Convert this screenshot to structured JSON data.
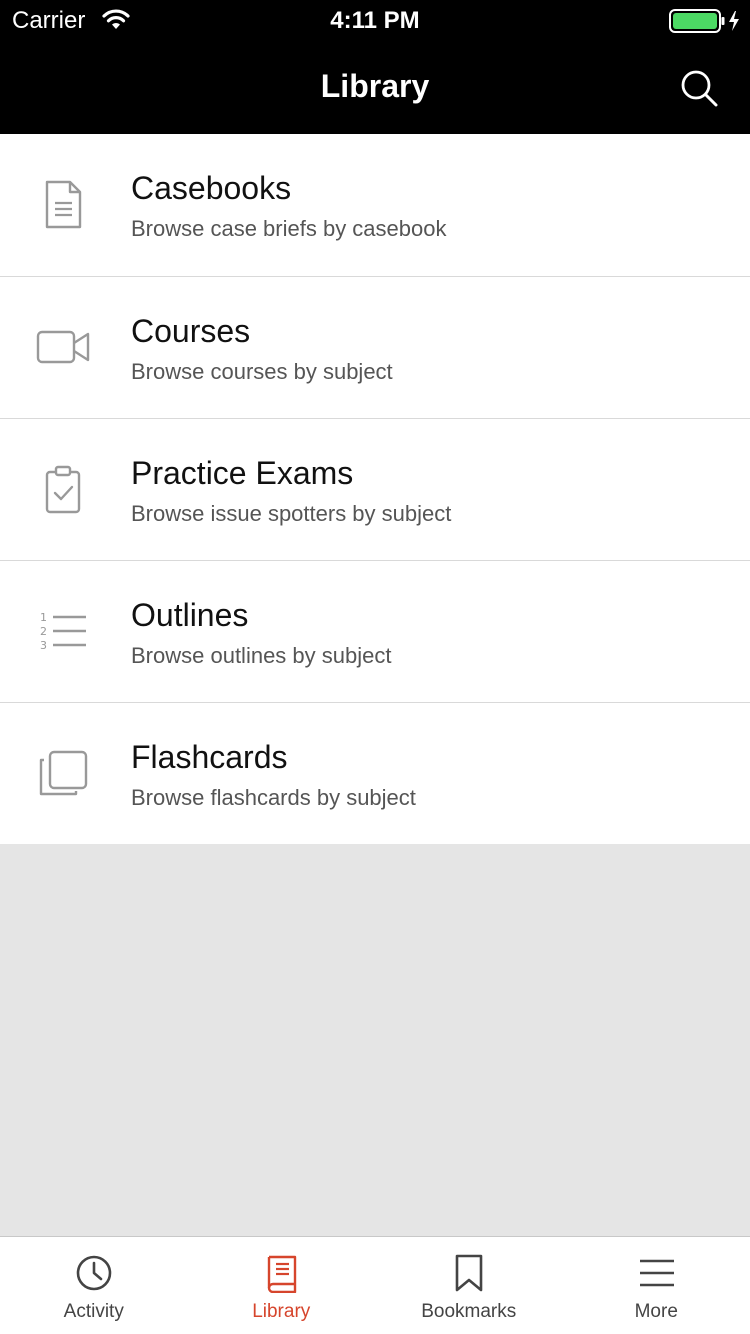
{
  "status_bar": {
    "carrier": "Carrier",
    "time": "4:11 PM",
    "battery_color": "#4cd964"
  },
  "nav": {
    "title": "Library",
    "search_icon": "search-icon"
  },
  "list": {
    "items": [
      {
        "title": "Casebooks",
        "subtitle": "Browse case briefs by casebook",
        "icon": "document-icon"
      },
      {
        "title": "Courses",
        "subtitle": "Browse courses by subject",
        "icon": "video-camera-icon"
      },
      {
        "title": "Practice Exams",
        "subtitle": "Browse issue spotters by subject",
        "icon": "clipboard-check-icon"
      },
      {
        "title": "Outlines",
        "subtitle": "Browse outlines by subject",
        "icon": "numbered-list-icon"
      },
      {
        "title": "Flashcards",
        "subtitle": "Browse flashcards by subject",
        "icon": "cards-stack-icon"
      }
    ]
  },
  "tab_bar": {
    "active_color": "#d6452c",
    "tabs": [
      {
        "label": "Activity",
        "icon": "clock-icon",
        "active": false
      },
      {
        "label": "Library",
        "icon": "book-icon",
        "active": true
      },
      {
        "label": "Bookmarks",
        "icon": "bookmark-icon",
        "active": false
      },
      {
        "label": "More",
        "icon": "menu-icon",
        "active": false
      }
    ]
  }
}
